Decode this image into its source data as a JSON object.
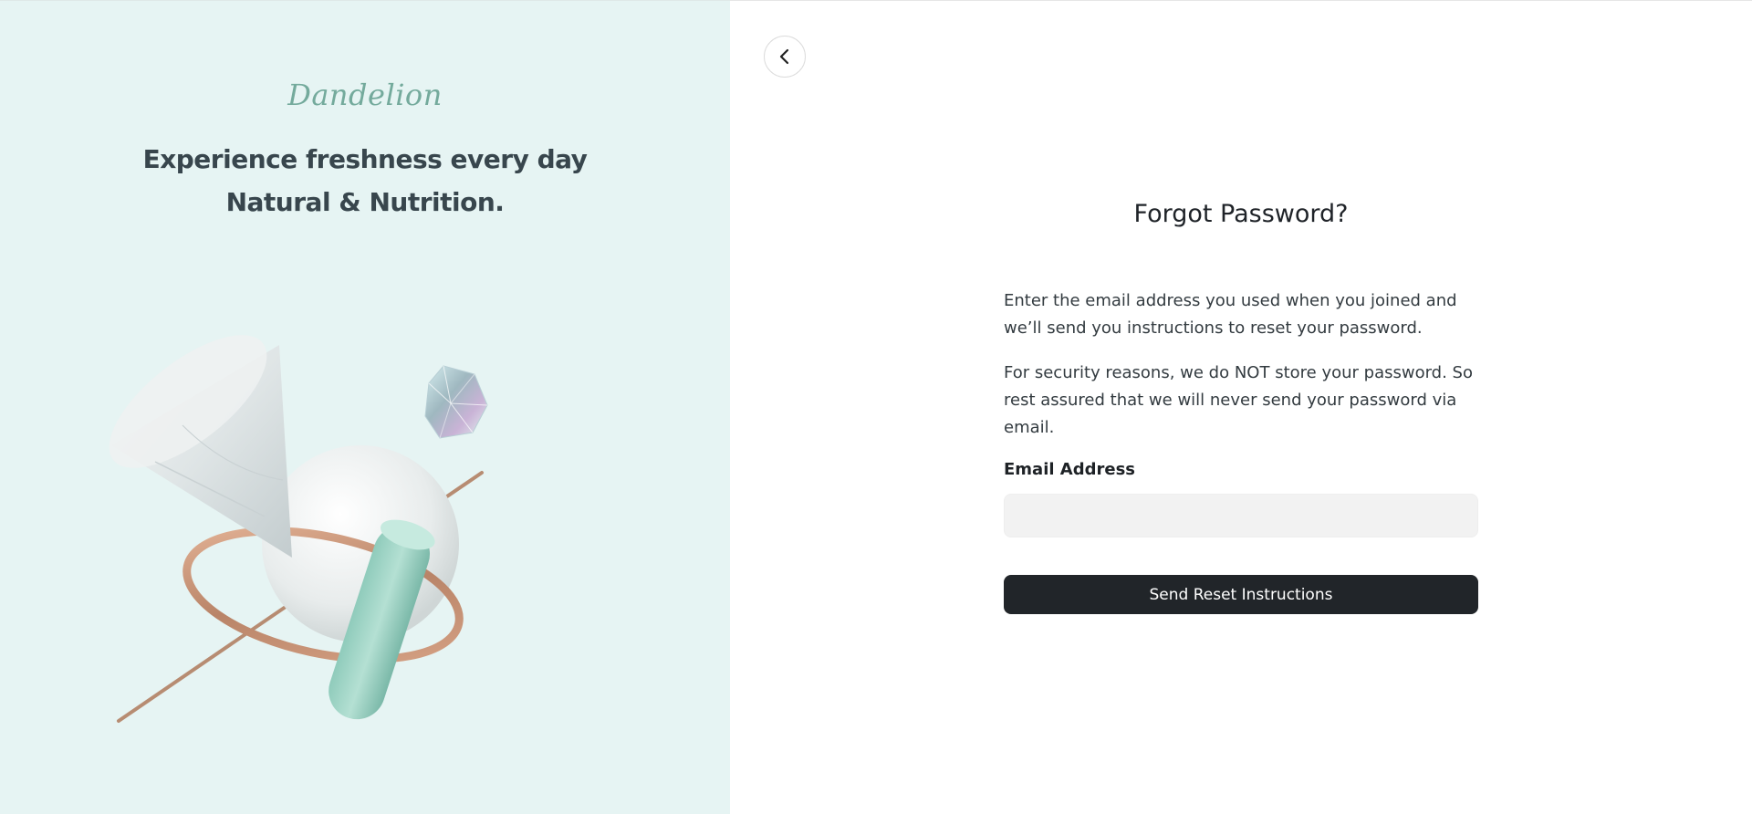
{
  "brand": {
    "logo_text": "Dandelion",
    "tagline_line1": "Experience freshness every day",
    "tagline_line2": "Natural & Nutrition.",
    "panel_color": "#e6f4f3",
    "logo_color": "#74aa9c"
  },
  "nav": {
    "back_icon": "chevron-left-icon"
  },
  "form": {
    "title": "Forgot Password?",
    "description_1": "Enter the email address you used when you joined and we’ll send you instructions to reset your password.",
    "description_2": "For security reasons, we do NOT store your password. So rest assured that we will never send your password via email.",
    "email_label": "Email Address",
    "email_value": "",
    "email_placeholder": "",
    "submit_label": "Send Reset Instructions",
    "submit_color": "#212529"
  }
}
